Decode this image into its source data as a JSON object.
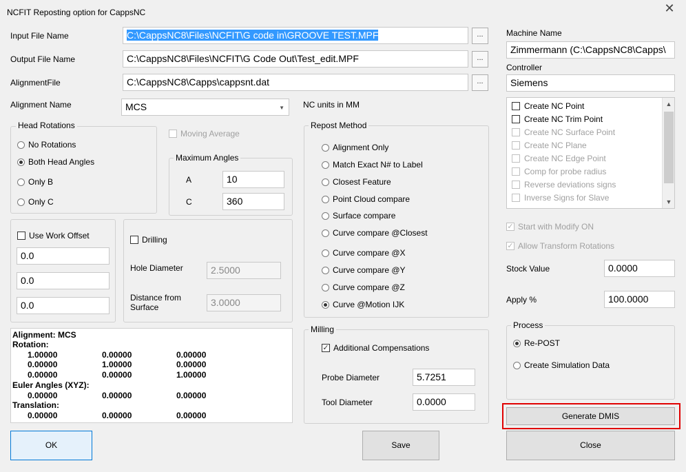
{
  "window": {
    "title": "NCFIT Reposting option for CappsNC"
  },
  "files": {
    "input_label": "Input File Name",
    "input_value": "C:\\CappsNC8\\Files\\NCFIT\\G code in\\GROOVE TEST.MPF",
    "output_label": "Output File Name",
    "output_value": "C:\\CappsNC8\\Files\\NCFIT\\G Code Out\\Test_edit.MPF",
    "alignment_file_label": "AlignmentFile",
    "alignment_file_value": "C:\\CappsNC8\\Capps\\cappsnt.dat",
    "browse_label": "..."
  },
  "alignment": {
    "label": "Alignment Name",
    "selected": "MCS"
  },
  "nc_units": "NC units in MM",
  "machine": {
    "name_label": "Machine Name",
    "name_value": "Zimmermann    (C:\\CappsNC8\\Capps\\",
    "controller_label": "Controller",
    "controller_value": "Siemens"
  },
  "head_rotations": {
    "title": "Head Rotations",
    "options": [
      "No Rotations",
      "Both Head Angles",
      "Only B",
      "Only C"
    ],
    "selected": "Both Head Angles"
  },
  "moving_average": {
    "label": "Moving Average",
    "checked": false,
    "enabled": false
  },
  "max_angles": {
    "title": "Maximum  Angles",
    "a_label": "A",
    "a_value": "10",
    "c_label": "C",
    "c_value": "360"
  },
  "work_offset": {
    "label": "Use Work Offset",
    "checked": false,
    "values": [
      "0.0",
      "0.0",
      "0.0"
    ]
  },
  "drilling": {
    "label": "Drilling",
    "checked": false,
    "hole_diameter_label": "Hole Diameter",
    "hole_diameter_value": "2.5000",
    "distance_label_1": "Distance from",
    "distance_label_2": "Surface",
    "distance_value": "3.0000"
  },
  "repost_method": {
    "title": "Repost Method",
    "options": [
      "Alignment Only",
      "Match Exact N# to Label",
      "Closest Feature",
      "Point Cloud compare",
      "Surface compare",
      "Curve compare @Closest",
      "Curve compare @X",
      "Curve compare @Y",
      "Curve compare @Z",
      "Curve @Motion IJK"
    ],
    "selected": "Curve @Motion IJK"
  },
  "milling": {
    "title": "Milling",
    "additional_comp_label": "Additional Compensations",
    "additional_comp_checked": true,
    "probe_label": "Probe Diameter",
    "probe_value": "5.7251",
    "tool_label": "Tool Diameter",
    "tool_value": "0.0000"
  },
  "alignment_info": {
    "header": "Alignment: MCS",
    "rotation_label": "Rotation:",
    "rotation_rows": [
      [
        "1.00000",
        "0.00000",
        "0.00000"
      ],
      [
        "0.00000",
        "1.00000",
        "0.00000"
      ],
      [
        "0.00000",
        "0.00000",
        "1.00000"
      ]
    ],
    "euler_label": "Euler Angles (XYZ):",
    "euler_row": [
      "0.00000",
      "0.00000",
      "0.00000"
    ],
    "translation_label": "Translation:",
    "translation_row": [
      "0.00000",
      "0.00000",
      "0.00000"
    ]
  },
  "nc_points": {
    "items": [
      {
        "label": "Create NC Point",
        "enabled": true
      },
      {
        "label": "Create NC Trim Point",
        "enabled": true
      },
      {
        "label": "Create NC Surface Point",
        "enabled": false
      },
      {
        "label": "Create NC Plane",
        "enabled": false
      },
      {
        "label": "Create NC Edge Point",
        "enabled": false
      },
      {
        "label": "Comp for probe radius",
        "enabled": false
      },
      {
        "label": "Reverse deviations signs",
        "enabled": false
      },
      {
        "label": "Inverse Signs for Slave",
        "enabled": false
      }
    ]
  },
  "start_modify": {
    "label": "Start with Modify ON",
    "checked": true,
    "enabled": false
  },
  "allow_transform": {
    "label": "Allow Transform Rotations",
    "checked": true,
    "enabled": false
  },
  "stock": {
    "label": "Stock Value",
    "value": "0.0000"
  },
  "apply": {
    "label": "Apply  %",
    "value": "100.0000"
  },
  "process": {
    "title": "Process",
    "options": [
      "Re-POST",
      "Create Simulation Data"
    ],
    "selected": "Re-POST"
  },
  "buttons": {
    "generate_dmis": "Generate DMIS",
    "ok": "OK",
    "save": "Save",
    "close": "Close"
  }
}
